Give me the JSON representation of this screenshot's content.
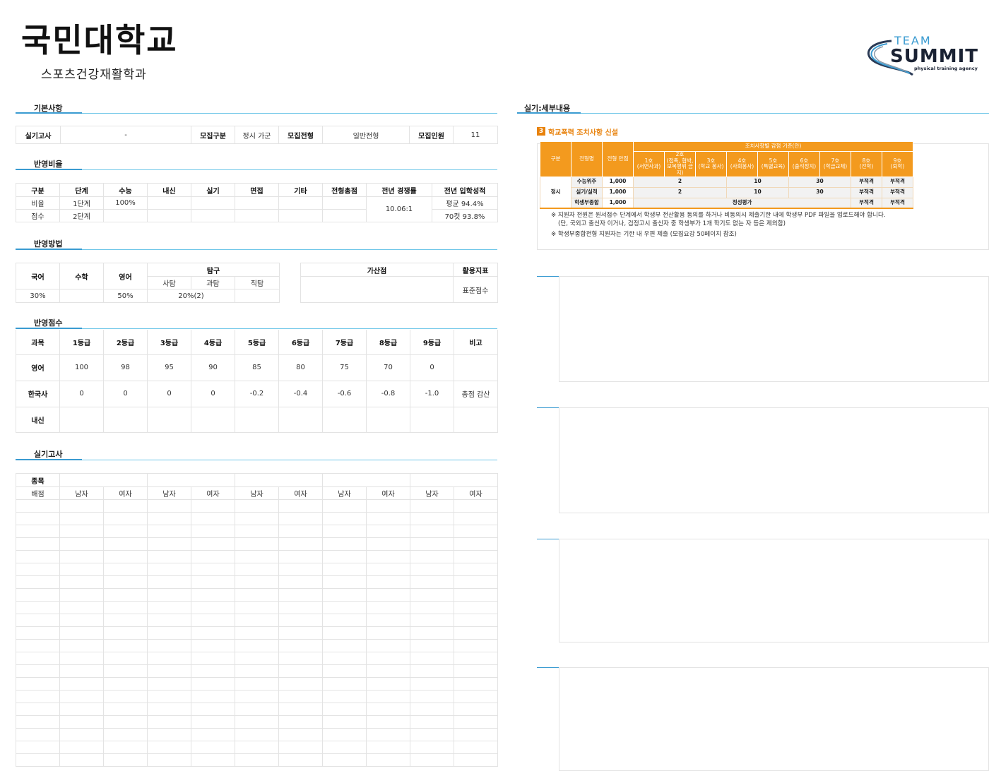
{
  "header": {
    "title": "국민대학교",
    "subtitle": "스포츠건강재활학과"
  },
  "logo": {
    "line1": "TEAM",
    "line2": "SUMMIT",
    "tagline": "physical training agency"
  },
  "sections": {
    "basic": "기본사항",
    "ratio": "반영비율",
    "method": "반영방법",
    "score": "반영점수",
    "practical": "실기고사",
    "detail": "실기:세부내용"
  },
  "basic": {
    "practical_label": "실기고사",
    "practical_value": "-",
    "recruit_type_label": "모집구분",
    "recruit_type_value": "정시 가군",
    "admission_label": "모집전형",
    "admission_value": "일반전형",
    "quota_label": "모집인원",
    "quota_value": "11"
  },
  "ratio": {
    "headers": [
      "구분",
      "단계",
      "수능",
      "내신",
      "실기",
      "면접",
      "기타",
      "전형총점",
      "전년 경쟁률",
      "전년 입학성적"
    ],
    "row1": [
      "비율",
      "1단계",
      "100%",
      "",
      "",
      "",
      "",
      ""
    ],
    "row2": [
      "점수",
      "2단계",
      "",
      "",
      "",
      "",
      "",
      ""
    ],
    "competition": "10.06:1",
    "avg": "평균 94.4%",
    "cut": "70컷 93.8%"
  },
  "method": {
    "korean": "국어",
    "math": "수학",
    "english": "영어",
    "inquiry": "탐구",
    "social": "사탐",
    "science": "과탐",
    "vocational": "직탐",
    "korean_val": "30%",
    "math_val": "",
    "english_val": "50%",
    "inquiry_val": "20%(2)",
    "bonus": "가산점",
    "indicator": "활용지표",
    "indicator_val": "표준점수"
  },
  "score": {
    "headers": [
      "과목",
      "1등급",
      "2등급",
      "3등급",
      "4등급",
      "5등급",
      "6등급",
      "7등급",
      "8등급",
      "9등급",
      "비고"
    ],
    "rows": [
      [
        "영어",
        "100",
        "98",
        "95",
        "90",
        "85",
        "80",
        "75",
        "70",
        "0",
        ""
      ],
      [
        "한국사",
        "0",
        "0",
        "0",
        "0",
        "-0.2",
        "-0.4",
        "-0.6",
        "-0.8",
        "-1.0",
        "총점 감산"
      ],
      [
        "내신",
        "",
        "",
        "",
        "",
        "",
        "",
        "",
        "",
        "",
        ""
      ]
    ]
  },
  "practical": {
    "event": "종목",
    "score": "배점",
    "male": "남자",
    "female": "여자"
  },
  "notice": {
    "num": "3",
    "title": "학교폭력 조치사항 신설",
    "h_group": "구분",
    "h_type": "전형명",
    "h_total": "전형 만점",
    "h_criteria": "조치사항별 감점 기준(안)",
    "cols": [
      [
        "1호",
        "(서면사과)"
      ],
      [
        "2호",
        "(접촉, 협박,",
        "보복행위 금지)"
      ],
      [
        "3호",
        "(학교 봉사)"
      ],
      [
        "4호",
        "(사회봉사)"
      ],
      [
        "5호",
        "(특별교육)"
      ],
      [
        "6호",
        "(출석정지)"
      ],
      [
        "7호",
        "(학급교체)"
      ],
      [
        "8호",
        "(전학)"
      ],
      [
        "9호",
        "(퇴학)"
      ]
    ],
    "group": "정시",
    "rows": [
      {
        "name": "수능위주",
        "total": "1,000",
        "v12": "2",
        "v34": "10",
        "v56": "30",
        "v8": "부적격",
        "v9": "부적격"
      },
      {
        "name": "실기/실적",
        "total": "1,000",
        "v12": "2",
        "v34": "10",
        "v56": "30",
        "v8": "부적격",
        "v9": "부적격"
      },
      {
        "name": "학생부종합",
        "total": "1,000",
        "mid": "정성평가",
        "v8": "부적격",
        "v9": "부적격"
      }
    ],
    "note1": "※ 지원자 전원은 원서접수 단계에서 학생부 전산활용 동의를 하거나 비동의시 제출기한 내에 학생부 PDF 파일을 업로드해야 합니다.",
    "note1b": "(단, 국외고 출신자 이거나, 검정고시 출신자 중 학생부가 1개 학기도 없는 자 등은 제외함)",
    "note2": "※ 학생부종합전형 지원자는 기한 내 우편 제출 (모집요강 50페이지 참조)"
  }
}
